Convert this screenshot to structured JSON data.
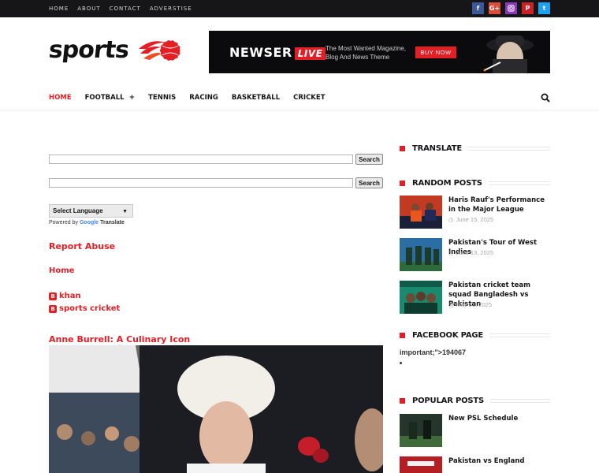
{
  "topnav": {
    "items": [
      "HOME",
      "ABOUT",
      "CONTACT",
      "ADVERSTISE"
    ],
    "socials": [
      {
        "icon": "facebook-icon",
        "glyph": "f",
        "color": "#3b5998"
      },
      {
        "icon": "google-plus-icon",
        "glyph": "G+",
        "color": "#dd4b39"
      },
      {
        "icon": "instagram-icon",
        "glyph": "◘",
        "color": "#8a3ab9"
      },
      {
        "icon": "pinterest-icon",
        "glyph": "P",
        "color": "#cb2027"
      },
      {
        "icon": "twitter-icon",
        "glyph": "t",
        "color": "#1da1f2"
      }
    ]
  },
  "logo": {
    "text": "sports"
  },
  "banner": {
    "brand": "NEWSER",
    "live": "LIVE",
    "tagline": "The Most Wanted Magazine, Blog And News Theme",
    "button": "BUY NOW"
  },
  "mainnav": {
    "home": "HOME",
    "football": "FOOTBALL",
    "plus": "+",
    "tennis": "TENNIS",
    "racing": "RACING",
    "basketball": "BASKETBALL",
    "cricket": "CRICKET"
  },
  "search": {
    "button1": "Search",
    "button2": "Search"
  },
  "translate": {
    "select_label": "Select Language",
    "powered_by": "Powered by",
    "google": "Google",
    "translate": "Translate"
  },
  "main": {
    "report_abuse": "Report Abuse",
    "home_link": "Home",
    "blog_links": [
      "khan",
      "sports cricket"
    ],
    "post_title": "Anne Burrell: A Culinary Icon"
  },
  "sidebar": {
    "translate_title": "TRANSLATE",
    "random_title": "RANDOM POSTS",
    "random_posts": [
      {
        "title": "Haris Rauf's Performance in the Major League",
        "date": "June 15, 2025"
      },
      {
        "title": "Pakistan's Tour of West Indies",
        "date": "June 13, 2025"
      },
      {
        "title": "Pakistan cricket team squad Bangladesh vs Pakistan",
        "date": "May 21, 2025"
      }
    ],
    "facebook_title": "FACEBOOK PAGE",
    "facebook_text": "important;\">194067",
    "popular_title": "POPULAR POSTS",
    "popular_posts": [
      {
        "title": "New PSL Schedule"
      },
      {
        "title": "Pakistan vs England"
      }
    ]
  },
  "colors": {
    "accent": "#e31e24",
    "dark": "#161619"
  }
}
